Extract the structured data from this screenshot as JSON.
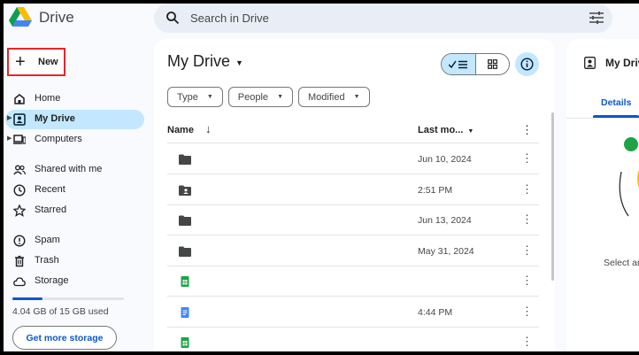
{
  "app": {
    "name": "Drive"
  },
  "search": {
    "placeholder": "Search in Drive"
  },
  "new_button": {
    "label": "New"
  },
  "sidebar": {
    "items": [
      {
        "label": "Home",
        "icon": "home-icon"
      },
      {
        "label": "My Drive",
        "icon": "my-drive-icon",
        "active": true
      },
      {
        "label": "Computers",
        "icon": "computers-icon"
      },
      {
        "label": "Shared with me",
        "icon": "shared-icon"
      },
      {
        "label": "Recent",
        "icon": "clock-icon"
      },
      {
        "label": "Starred",
        "icon": "star-icon"
      },
      {
        "label": "Spam",
        "icon": "spam-icon"
      },
      {
        "label": "Trash",
        "icon": "trash-icon"
      },
      {
        "label": "Storage",
        "icon": "cloud-icon"
      }
    ]
  },
  "storage": {
    "used_text": "4.04 GB of 15 GB used",
    "used_fraction": 0.27,
    "cta": "Get more storage"
  },
  "main": {
    "title": "My Drive",
    "filters": [
      "Type",
      "People",
      "Modified"
    ],
    "columns": {
      "name": "Name",
      "modified": "Last mo..."
    },
    "rows": [
      {
        "icon": "folder-icon",
        "modified": "Jun 10, 2024"
      },
      {
        "icon": "shared-folder-icon",
        "modified": "2:51 PM"
      },
      {
        "icon": "folder-icon",
        "modified": "Jun 13, 2024"
      },
      {
        "icon": "folder-icon",
        "modified": "May 31, 2024"
      },
      {
        "icon": "sheets-icon",
        "modified": ""
      },
      {
        "icon": "docs-icon",
        "modified": "4:44 PM"
      },
      {
        "icon": "sheets-icon",
        "modified": ""
      }
    ]
  },
  "details": {
    "title": "My Drive",
    "tab": "Details",
    "empty_text": "Select an item to see the details"
  },
  "colors": {
    "accent": "#0b57d0",
    "selected": "#c2e7ff",
    "highlight_border": "#e8262a",
    "background": "#f8fafd"
  }
}
